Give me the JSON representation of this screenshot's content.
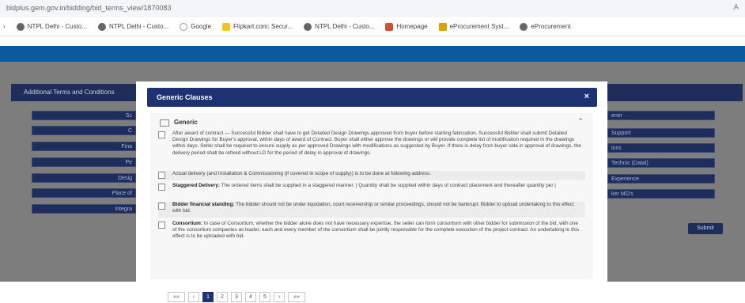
{
  "browser": {
    "url": "bidplus.gem.gov.in/bidding/bid_terms_view/1870083",
    "bookmarks": [
      {
        "label": "NTPL Delhi - Custo...",
        "icon": "globe-icon"
      },
      {
        "label": "NTPL Delhi - Custo...",
        "icon": "globe-icon"
      },
      {
        "label": "Google",
        "icon": "google-icon"
      },
      {
        "label": "Flipkart.com: Secur...",
        "icon": "flipkart-icon"
      },
      {
        "label": "NTPL Delhi - Custo...",
        "icon": "globe-icon"
      },
      {
        "label": "Homepage",
        "icon": "home-icon"
      },
      {
        "label": "eProcurement Syst...",
        "icon": "eproc-icon"
      },
      {
        "label": "eProcurement",
        "icon": "globe-icon"
      }
    ]
  },
  "background": {
    "panel_title": "Additional Terms and Conditions",
    "left_buttons": [
      "Sc",
      "C",
      "Fina",
      "Pe",
      "Desig",
      "Place of",
      "Integra"
    ],
    "right_buttons": [
      "ener",
      "Support",
      "ions",
      "Technic (Datal)",
      "Experience",
      "ker MO's"
    ],
    "submit_label": "Submit"
  },
  "modal": {
    "title": "Generic Clauses",
    "close_glyph": "×",
    "section_title": "Generic",
    "chevron": "⌃",
    "clauses": [
      {
        "bold": "",
        "text": "After award of contract — Successful Bidder shall have to get Detailed Design Drawings approved from buyer before starting fabrication. Successful Bidder shall submit Detailed Design Drawings for Buyer's approval, within days of award of Contract. Buyer shall either approve the drawings or will provide complete list of modification required in the drawings within days. Seller shall be required to ensure supply as per approved Drawings with modifications as suggested by Buyer. If there is delay from buyer side in approval of drawings, the delivery period shall be refixed without LD for the period of delay in approval of drawings."
      },
      {
        "bold": "",
        "text": "Actual delivery (and Installation & Commissioning (if covered in scope of supply)) is to be done at following address."
      },
      {
        "bold": "Staggered Delivery:",
        "text": " The ordered items shall be supplied in a staggered manner. | Quantity shall be supplied within days of contract placement and thereafter quantity per |"
      },
      {
        "bold": "Bidder financial standing:",
        "text": " The bidder should not be under liquidation, court receivership or similar proceedings, should not be bankrupt. Bidder to upload undertaking to this effect with bid."
      },
      {
        "bold": "Consortium:",
        "text": " In case of Consortium, whether the bidder alone does not have necessary expertise, the seller can form consortium with other bidder for submission of the bid, with one of the consortium companies as leader, each and every member of the consortium shall be jointly responsible for the complete execution of the project contract. An undertaking to this effect is to be uploaded with bid."
      }
    ],
    "pagination": [
      "««",
      "‹",
      "1",
      "2",
      "3",
      "4",
      "5",
      "›",
      "»»"
    ],
    "active_page": "1"
  }
}
